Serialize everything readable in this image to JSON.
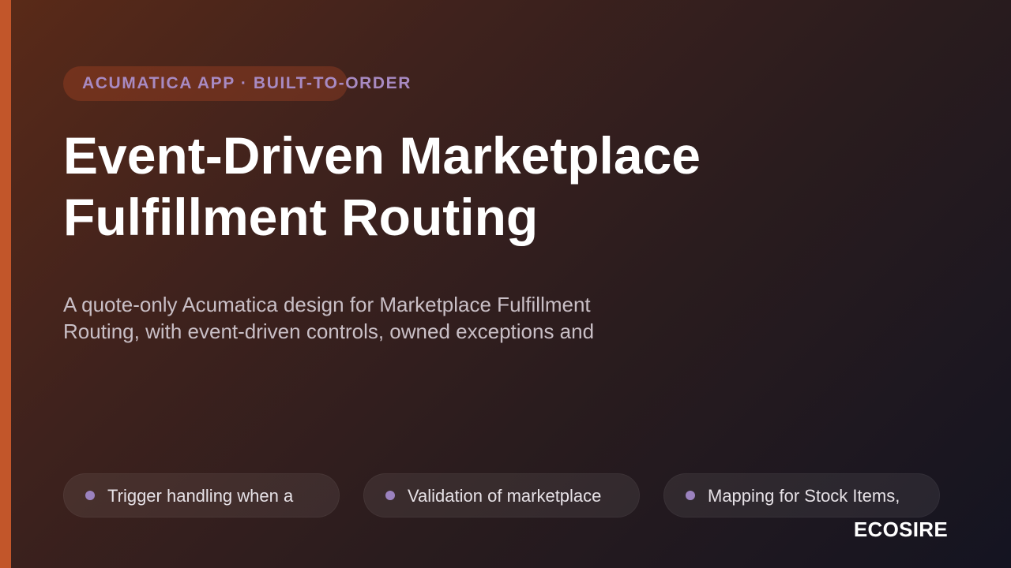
{
  "slide": {
    "eyebrow": "ACUMATICA APP · BUILT-TO-ORDER",
    "title_lines": [
      "Event-Driven Marketplace",
      "Fulfillment Routing"
    ],
    "subtitle_lines": [
      "A quote-only Acumatica design for Marketplace Fulfillment",
      "Routing, with event-driven controls, owned exceptions and"
    ],
    "chips": [
      {
        "label": "Trigger handling when a"
      },
      {
        "label": "Validation of marketplace"
      },
      {
        "label": "Mapping for Stock Items,"
      }
    ],
    "brand": "ECOSIRE"
  },
  "colors": {
    "accent": "#c2562a",
    "eyebrow_text": "#a88ac2",
    "chip_dot": "#9b82bf",
    "background_start": "#5a2a18",
    "background_end": "#141421"
  }
}
